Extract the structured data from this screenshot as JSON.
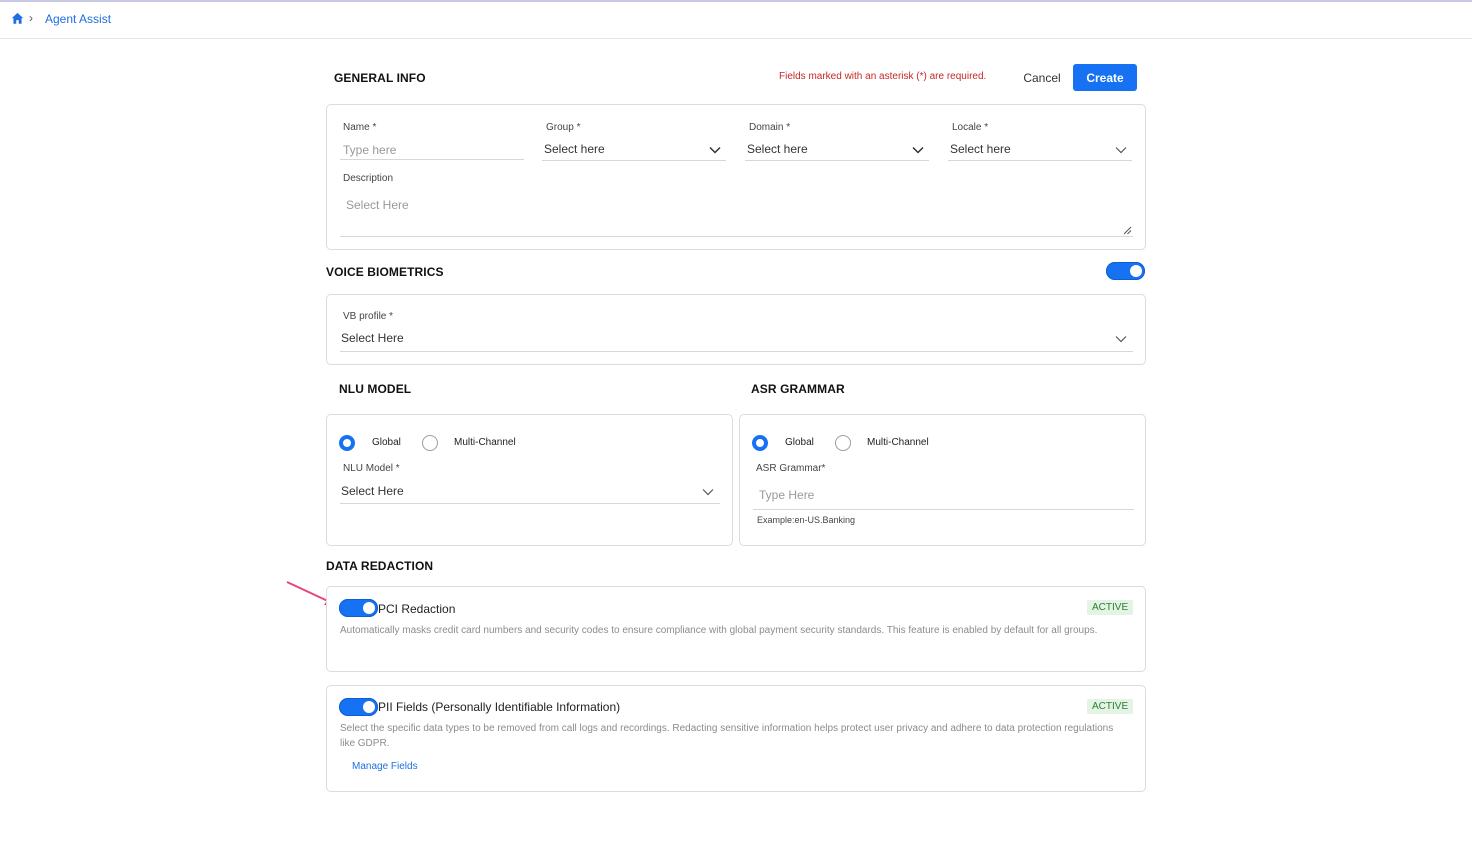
{
  "breadcrumb": {
    "home_icon": "home-icon",
    "separator": "›",
    "current": "Agent Assist"
  },
  "header": {
    "title": "GENERAL INFO",
    "required_note": "Fields marked with an asterisk (*) are required.",
    "cancel_label": "Cancel",
    "create_label": "Create"
  },
  "colors": {
    "accent": "#1672f3",
    "required": "#c62828",
    "active_bg": "#e3f4e4",
    "active_text": "#2e7d32",
    "annotation_arrow": "#e8457c"
  },
  "general": {
    "name_label": "Name *",
    "name_placeholder": "Type here",
    "group_label": "Group *",
    "group_value": "Select here",
    "domain_label": "Domain *",
    "domain_value": "Select here",
    "locale_label": "Locale *",
    "locale_value": "Select here",
    "description_label": "Description",
    "description_placeholder": "Select Here"
  },
  "voice_biometrics": {
    "title": "VOICE BIOMETRICS",
    "enabled": true,
    "vb_profile_label": "VB profile *",
    "vb_profile_value": "Select Here"
  },
  "nlu": {
    "title": "NLU MODEL",
    "option_global": "Global",
    "option_multi": "Multi-Channel",
    "selected": "Global",
    "model_label": "NLU Model *",
    "model_value": "Select Here"
  },
  "asr": {
    "title": "ASR GRAMMAR",
    "option_global": "Global",
    "option_multi": "Multi-Channel",
    "selected": "Global",
    "grammar_label": "ASR Grammar*",
    "grammar_placeholder": "Type Here",
    "example": "Example:en-US.Banking"
  },
  "redaction": {
    "title": "DATA REDACTION",
    "pci": {
      "title": "PCI Redaction",
      "status": "ACTIVE",
      "enabled": true,
      "description": "Automatically masks credit card numbers and security codes to ensure compliance with global payment security standards. This feature is enabled by default for all groups."
    },
    "pii": {
      "title": "PII Fields (Personally Identifiable Information)",
      "status": "ACTIVE",
      "enabled": true,
      "description": "Select the specific data types to be removed from call logs and recordings. Redacting sensitive information helps protect user privacy and adhere to data protection regulations like GDPR.",
      "manage_label": "Manage Fields"
    }
  }
}
